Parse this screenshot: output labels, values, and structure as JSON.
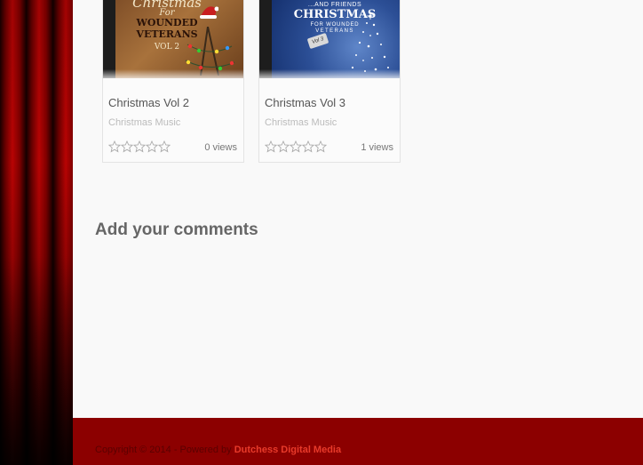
{
  "products": [
    {
      "title": "Christmas Vol 2",
      "category": "Christmas Music",
      "views": "0 views",
      "rating": 0,
      "cover": {
        "line1": "Christmas",
        "line2": "For",
        "line3": "WOUNDED",
        "line4": "VETERANS",
        "line5": "VOL 2"
      }
    },
    {
      "title": "Christmas Vol 3",
      "category": "Christmas Music",
      "views": "1 views",
      "rating": 0,
      "cover": {
        "line1": "...AND FRIENDS",
        "line2": "CHRISTMAS",
        "line3": "FOR WOUNDED",
        "line4": "VETERANS",
        "tag": "Vol 3"
      }
    }
  ],
  "comments": {
    "heading": "Add your comments"
  },
  "footer": {
    "copyright": "Copyright © 2014 - Powered by ",
    "link_text": "Dutchess Digital Media"
  },
  "colors": {
    "footer_bg": "#8c0000",
    "footer_link": "#e83a2a",
    "curtain": "#b00000"
  }
}
